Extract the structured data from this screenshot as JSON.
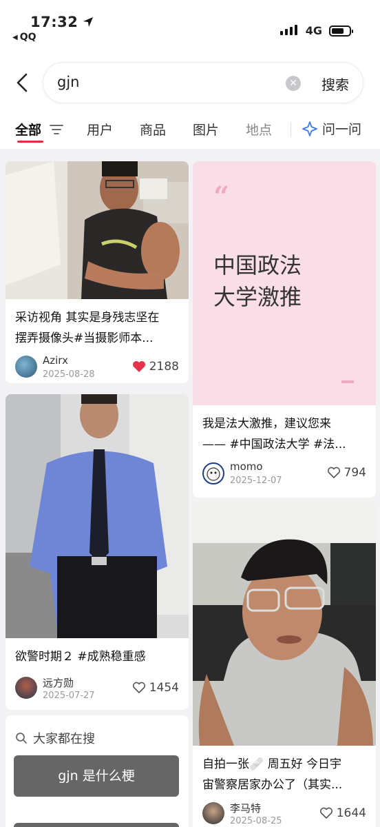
{
  "status_bar": {
    "time": "17:32",
    "back_app": "QQ",
    "network": "4G"
  },
  "search": {
    "query": "gjn",
    "submit_label": "搜索"
  },
  "tabs": [
    {
      "label": "全部"
    },
    {
      "label": "用户"
    },
    {
      "label": "商品"
    },
    {
      "label": "图片"
    },
    {
      "label": "地点"
    }
  ],
  "ask_label": "问一问",
  "cards": [
    {
      "title_line1": "采访视角 其实是身残志坚在",
      "title_line2": "摆弄摄像头#当摄影师本...",
      "author": "Azirx",
      "date": "2025-08-28",
      "likes": "2188",
      "liked": true
    },
    {
      "quote_line1_pre": "中国",
      "quote_line1_hl": "政法",
      "quote_line2": "大学激推",
      "title_line1": "我是法大激推，建议您来",
      "title_line2": "—— #中国政法大学 #法...",
      "author": "momo",
      "date": "2025-12-07",
      "likes": "794",
      "liked": false
    },
    {
      "title_line1": "欲警时期２ #成熟稳重感",
      "author": "远方勋",
      "date": "2025-07-27",
      "likes": "1454",
      "liked": false
    },
    {
      "title_line1": "自拍一张🩹 周五好 今日宇",
      "title_line2": "宙警察居家办公了（其实...",
      "author": "李马特",
      "date": "2025-08-25",
      "likes": "1644",
      "liked": false
    }
  ],
  "popular": {
    "heading": "大家都在搜",
    "items": [
      "gjn 是什么梗",
      ""
    ]
  },
  "colors": {
    "accent": "#e02e3d",
    "pink_card": "#f9dde7",
    "highlight": "#9de6b5"
  }
}
